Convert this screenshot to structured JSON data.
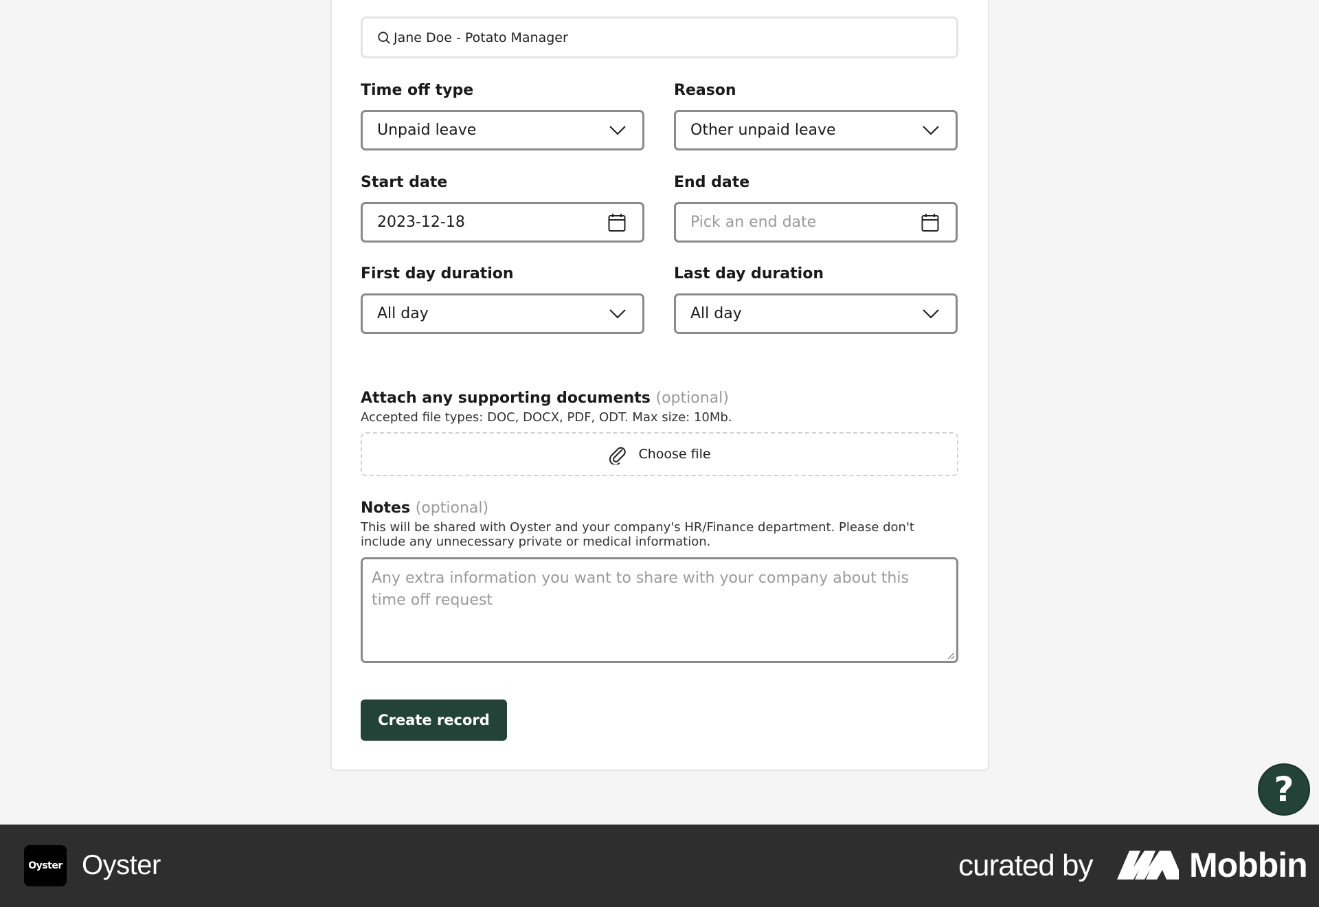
{
  "search": {
    "value": "Jane Doe - Potato Manager",
    "icon": "search-icon"
  },
  "time_off_type": {
    "label": "Time off type",
    "value": "Unpaid leave"
  },
  "reason": {
    "label": "Reason",
    "value": "Other unpaid leave"
  },
  "start_date": {
    "label": "Start date",
    "value": "2023-12-18"
  },
  "end_date": {
    "label": "End date",
    "placeholder": "Pick an end date"
  },
  "first_day": {
    "label": "First day duration",
    "value": "All day"
  },
  "last_day": {
    "label": "Last day duration",
    "value": "All day"
  },
  "attachments": {
    "label": "Attach any supporting documents",
    "optional": "(optional)",
    "hint": "Accepted file types: DOC, DOCX, PDF, ODT. Max size: 10Mb.",
    "button": "Choose file"
  },
  "notes": {
    "label": "Notes",
    "optional": "(optional)",
    "hint": "This will be shared with Oyster and your company's HR/Finance department. Please don't include any unnecessary private or medical information.",
    "placeholder": "Any extra information you want to share with your company about this time off request"
  },
  "submit": {
    "label": "Create record"
  },
  "help": {
    "label": "?"
  },
  "footer": {
    "logo_text": "Oyster",
    "app_name": "Oyster",
    "curated_by": "curated by",
    "brand": "Mobbin"
  },
  "colors": {
    "primary": "#234338",
    "border": "#8a8a8a",
    "footer_bg": "#2e2e2e",
    "page_bg": "#f5f5f5"
  }
}
